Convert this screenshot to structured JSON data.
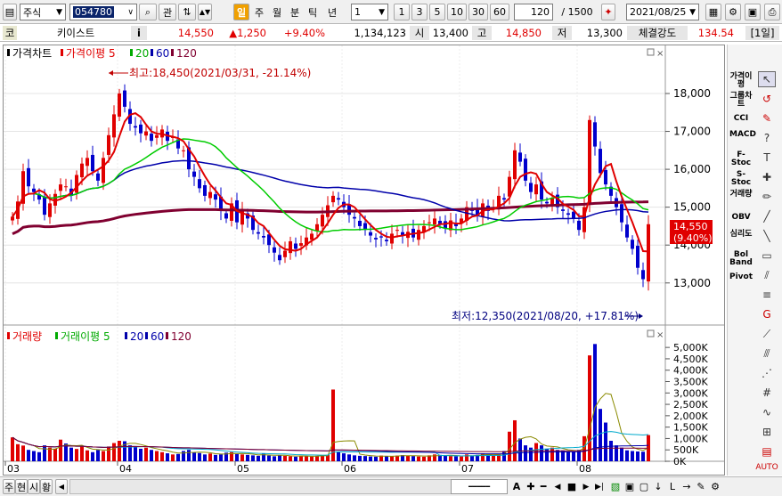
{
  "toolbar": {
    "market": "주식",
    "code": "054780",
    "search_btn": "관",
    "periods": [
      "일",
      "주",
      "월",
      "분",
      "틱",
      "년"
    ],
    "interval": "1",
    "nums": [
      "1",
      "3",
      "5",
      "10",
      "30",
      "60"
    ],
    "count": "120",
    "total": "/ 1500",
    "date": "2021/08/25"
  },
  "info": {
    "cat": "코",
    "name": "키이스트",
    "i": "i",
    "price": "14,550",
    "change": "▲1,250",
    "pct": "+9.40%",
    "volume": "1,134,123",
    "open_lab": "시",
    "open": "13,400",
    "high_lab": "고",
    "high": "14,850",
    "low_lab": "저",
    "low": "13,300",
    "str_lab": "체결강도",
    "str": "134.54",
    "period": "[1일]"
  },
  "price_legend": {
    "title": "가격차트",
    "ma_label": "가격이평 5",
    "ma20": "20",
    "ma60": "60",
    "ma120": "120"
  },
  "vol_legend": {
    "title": "거래량",
    "ma_label": "거래이평 5",
    "ma20": "20",
    "ma60": "60",
    "ma120": "120"
  },
  "annot": {
    "high": "최고:18,450(2021/03/31, -21.14%)",
    "low": "최저:12,350(2021/08/20, +17.81%)"
  },
  "price_tag": {
    "price": "14,550",
    "pct": "(9.40%)"
  },
  "price_axis": [
    "18,000",
    "17,000",
    "16,000",
    "15,000",
    "14,000",
    "13,000"
  ],
  "vol_axis": [
    "5,000K",
    "4,500K",
    "4,000K",
    "3,500K",
    "3,000K",
    "2,500K",
    "2,000K",
    "1,500K",
    "1,000K",
    "500K",
    "0K"
  ],
  "x_axis": [
    "03",
    "04",
    "05",
    "06",
    "07",
    "08"
  ],
  "sidebar": [
    "가격이평",
    "그룹차트",
    "CCI",
    "MACD",
    "F-Stoc",
    "S-Stoc",
    "거래량",
    "OBV",
    "심리도",
    "Bol Band",
    "Pivot"
  ],
  "bottom": {
    "tabs": [
      "주",
      "현",
      "시",
      "황"
    ],
    "scroll_left": "◀",
    "A": "A"
  },
  "colors": {
    "up": "#e00000",
    "down": "#0000cc",
    "ma5": "#e00000",
    "ma20": "#00cc00",
    "ma60": "#0000aa",
    "ma120": "#800030"
  },
  "chart_data": {
    "type": "candlestick",
    "ylim": [
      12350,
      18450
    ],
    "xticks": [
      "03",
      "04",
      "05",
      "06",
      "07",
      "08"
    ],
    "closes": [
      14750,
      15150,
      15950,
      15550,
      15400,
      15200,
      14800,
      15100,
      15350,
      15600,
      15550,
      15300,
      15850,
      16150,
      16300,
      15950,
      15700,
      16300,
      16900,
      17450,
      18000,
      17650,
      17200,
      17100,
      16950,
      17000,
      16750,
      16900,
      17050,
      16750,
      16850,
      16550,
      16500,
      16000,
      15800,
      15500,
      15300,
      15400,
      15200,
      14900,
      14700,
      15100,
      14600,
      14900,
      14700,
      14400,
      14300,
      14200,
      14000,
      13800,
      13600,
      13850,
      14100,
      13900,
      14050,
      14200,
      14300,
      14550,
      14800,
      15050,
      15300,
      15200,
      15000,
      14800,
      14700,
      14500,
      14400,
      14250,
      14150,
      14200,
      14100,
      14300,
      14400,
      14250,
      14350,
      14200,
      14400,
      14500,
      14600,
      14700,
      14550,
      14450,
      14650,
      14500,
      14700,
      15000,
      14900,
      14800,
      15100,
      14900,
      15000,
      15300,
      15200,
      15800,
      16500,
      16200,
      15700,
      15400,
      15600,
      15200,
      15100,
      15250,
      15000,
      14900,
      14800,
      14700,
      14400,
      15000,
      17300,
      16600,
      15900,
      15600,
      15300,
      15000,
      14600,
      14200,
      13900,
      13400,
      13100,
      14550
    ],
    "volume_K": [
      1050,
      750,
      690,
      500,
      450,
      400,
      700,
      600,
      550,
      950,
      780,
      600,
      540,
      650,
      480,
      400,
      500,
      450,
      650,
      800,
      900,
      880,
      700,
      650,
      550,
      600,
      500,
      450,
      400,
      350,
      300,
      320,
      450,
      500,
      380,
      360,
      300,
      340,
      280,
      300,
      380,
      400,
      320,
      300,
      280,
      260,
      240,
      350,
      250,
      220,
      260,
      240,
      220,
      200,
      250,
      230,
      210,
      240,
      260,
      280,
      3150,
      420,
      350,
      300,
      260,
      240,
      230,
      210,
      200,
      250,
      230,
      220,
      250,
      270,
      240,
      230,
      210,
      200,
      260,
      300,
      280,
      240,
      230,
      220,
      210,
      300,
      250,
      280,
      350,
      300,
      260,
      290,
      450,
      1300,
      1800,
      1000,
      700,
      600,
      800,
      700,
      550,
      600,
      500,
      450,
      420,
      430,
      500,
      1100,
      4650,
      5150,
      2300,
      1700,
      900,
      700,
      600,
      480,
      450,
      430,
      420,
      1150
    ]
  }
}
